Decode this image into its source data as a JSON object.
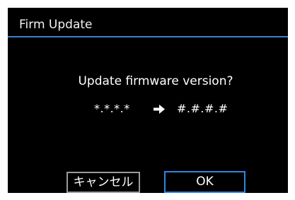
{
  "dialog": {
    "title": "Firm Update",
    "question": "Update firmware version?",
    "current_version": "*.*.*.*",
    "new_version": "#.#.#.#",
    "arrow_icon": "right-arrow-icon"
  },
  "buttons": {
    "cancel_label": "キャンセル",
    "ok_label": "OK"
  },
  "colors": {
    "background": "#000000",
    "text": "#ffffff",
    "accent": "#2f86e0"
  }
}
